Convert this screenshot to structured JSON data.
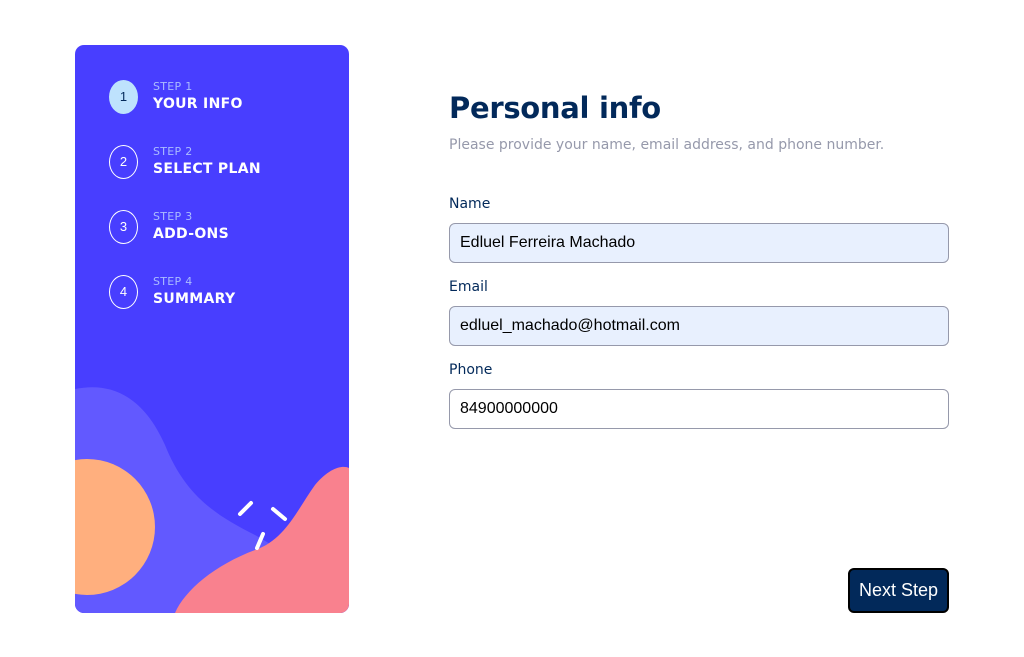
{
  "sidebar": {
    "steps": [
      {
        "number": "1",
        "label": "STEP 1",
        "name": "YOUR INFO",
        "active": true
      },
      {
        "number": "2",
        "label": "STEP 2",
        "name": "SELECT PLAN",
        "active": false
      },
      {
        "number": "3",
        "label": "STEP 3",
        "name": "ADD-ONS",
        "active": false
      },
      {
        "number": "4",
        "label": "STEP 4",
        "name": "SUMMARY",
        "active": false
      }
    ],
    "colors": {
      "background": "#483eff",
      "wave": "#6259ff",
      "orange_circle": "#ffaf7e",
      "pink_blob": "#f9818e",
      "active_circle": "#bee2fd"
    }
  },
  "main": {
    "title": "Personal info",
    "subtitle": "Please provide your name, email address, and phone number.",
    "fields": {
      "name": {
        "label": "Name",
        "value": "Edluel Ferreira Machado"
      },
      "email": {
        "label": "Email",
        "value": "edluel_machado@hotmail.com"
      },
      "phone": {
        "label": "Phone",
        "value": "84900000000"
      }
    },
    "next_button_label": "Next Step"
  },
  "colors": {
    "marine_blue": "#02295a",
    "cool_gray": "#9699ab",
    "autofill_bg": "#e8f0fe"
  }
}
